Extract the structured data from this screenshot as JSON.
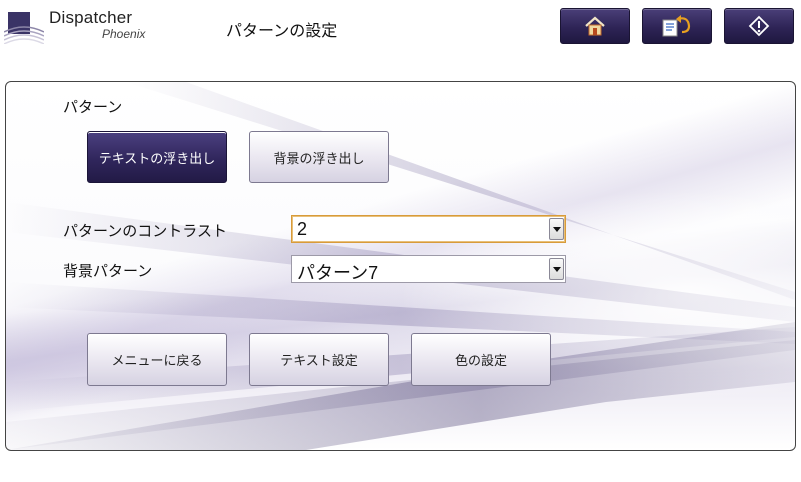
{
  "header": {
    "logo_line1": "Dispatcher",
    "logo_line2": "Phoenix",
    "title": "パターンの設定",
    "buttons": [
      {
        "icon": "home-icon"
      },
      {
        "icon": "job-undo-icon"
      },
      {
        "icon": "start-icon"
      }
    ]
  },
  "main": {
    "pattern_label": "パターン",
    "pattern_buttons": [
      {
        "label": "テキストの浮き出し",
        "selected": true
      },
      {
        "label": "背景の浮き出し",
        "selected": false
      }
    ],
    "contrast": {
      "label": "パターンのコントラスト",
      "value": "2"
    },
    "bg_pattern": {
      "label": "背景パターン",
      "value": "パターン7"
    },
    "bottom_buttons": {
      "back": "メニューに戻る",
      "text_settings": "テキスト設定",
      "color_settings": "色の設定"
    }
  },
  "colors": {
    "accent": "#2e2456",
    "focus_border": "#d89b3a"
  }
}
